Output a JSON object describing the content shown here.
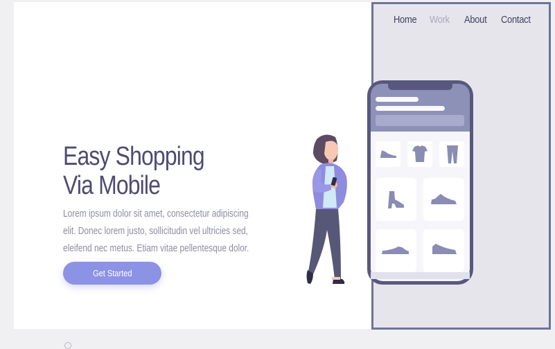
{
  "nav": {
    "items": [
      {
        "label": "Home",
        "active": false
      },
      {
        "label": "Work",
        "active": true
      },
      {
        "label": "About",
        "active": false
      },
      {
        "label": "Contact",
        "active": false
      }
    ]
  },
  "hero": {
    "title_line1": "Easy Shopping",
    "title_line2": "Via Mobile",
    "body": "Lorem ipsum dolor sit amet, consectetur  adipiscing elit. Donec lorem justo, sollicitudin vel ultricies sed, eleifend nec metus. Etiam vitae pellentesque dolor.",
    "cta_label": "Get Started"
  },
  "colors": {
    "background": "#f0f0f2",
    "panel": "#e7e5ec",
    "panel_border": "#6b7499",
    "title": "#4c4c72",
    "body_text": "#8c8ca4",
    "accent": "#8c92e4",
    "nav_active": "#a9a8ba"
  },
  "phone": {
    "products": [
      "shoe-icon",
      "tshirt-icon",
      "pants-icon",
      "boot-icon",
      "sneaker-icon",
      "sneaker-icon",
      "sneaker-icon"
    ]
  }
}
